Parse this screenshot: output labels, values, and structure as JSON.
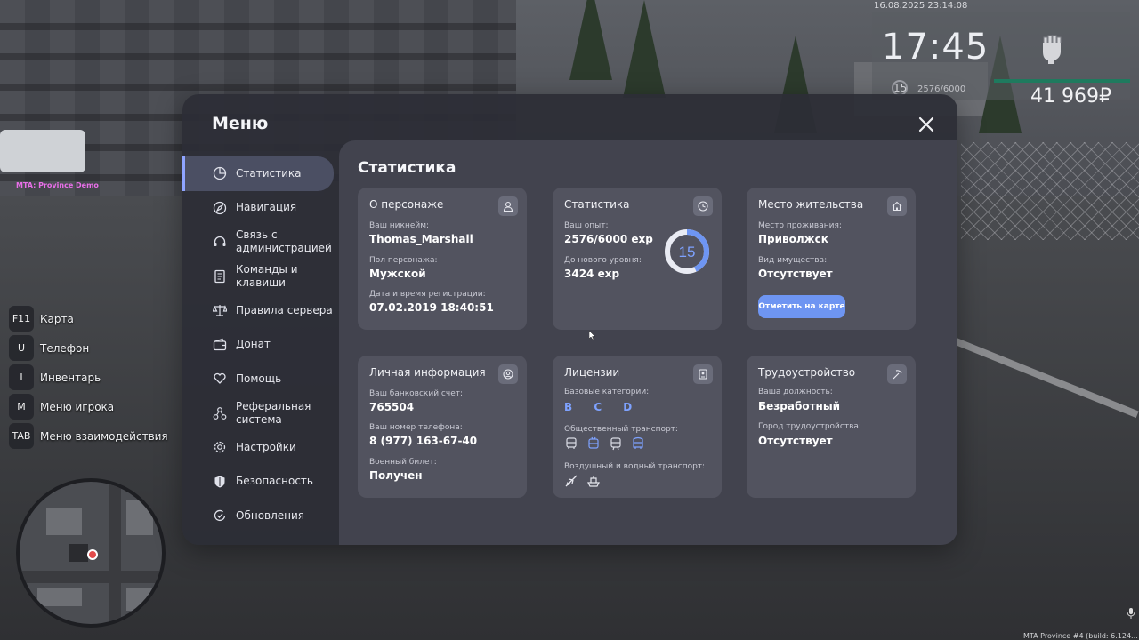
{
  "hud": {
    "datetime": "16.08.2025 23:14:08",
    "time": "17:45",
    "level": "15",
    "exp": "2576/6000",
    "money": "41 969₽"
  },
  "server_label": "MTA: Province Demo",
  "hotkeys": [
    {
      "key": "F11",
      "label": "Карта"
    },
    {
      "key": "U",
      "label": "Телефон"
    },
    {
      "key": "I",
      "label": "Инвентарь"
    },
    {
      "key": "M",
      "label": "Меню игрока"
    },
    {
      "key": "TAB",
      "label": "Меню взаимодействия"
    }
  ],
  "menu": {
    "title": "Меню",
    "nav": [
      {
        "label": "Статистика",
        "icon": "pie-chart-icon",
        "active": true
      },
      {
        "label": "Навигация",
        "icon": "compass-icon"
      },
      {
        "label": "Связь с\nадминистрацией",
        "icon": "headset-icon"
      },
      {
        "label": "Команды и\nклавиши",
        "icon": "document-icon"
      },
      {
        "label": "Правила сервера",
        "icon": "scales-icon"
      },
      {
        "label": "Донат",
        "icon": "wallet-icon"
      },
      {
        "label": "Помощь",
        "icon": "heart-hand-icon"
      },
      {
        "label": "Реферальная\nсистема",
        "icon": "referral-icon"
      },
      {
        "label": "Настройки",
        "icon": "gear-icon"
      },
      {
        "label": "Безопасность",
        "icon": "shield-icon"
      },
      {
        "label": "Обновления",
        "icon": "check-refresh-icon"
      }
    ]
  },
  "content": {
    "title": "Статистика",
    "character": {
      "title": "О персонаже",
      "nick_label": "Ваш никнейм:",
      "nick": "Thomas_Marshall",
      "gender_label": "Пол персонажа:",
      "gender": "Мужской",
      "reg_label": "Дата и время регистрации:",
      "reg": "07.02.2019 18:40:51"
    },
    "stats": {
      "title": "Статистика",
      "exp_label": "Ваш опыт:",
      "exp": "2576/6000 exp",
      "next_label": "До нового уровня:",
      "next": "3424 exp",
      "level": "15",
      "progress": 0.4293
    },
    "residence": {
      "title": "Место жительства",
      "place_label": "Место проживания:",
      "place": "Приволжск",
      "property_label": "Вид имущества:",
      "property": "Отсутствует",
      "button": "Отметить на карте"
    },
    "personal": {
      "title": "Личная информация",
      "bank_label": "Ваш банковский счет:",
      "bank": "765504",
      "phone_label": "Ваш номер телефона:",
      "phone": "8 (977) 163-67-40",
      "military_label": "Военный билет:",
      "military": "Получен"
    },
    "licenses": {
      "title": "Лицензии",
      "base_label": "Базовые категории:",
      "base": "B C D",
      "public_label": "Общественный транспорт:",
      "air_label": "Воздушный и водный транспорт:"
    },
    "employment": {
      "title": "Трудоустройство",
      "position_label": "Ваша должность:",
      "position": "Безработный",
      "city_label": "Город трудоустройства:",
      "city": "Отсутствует"
    }
  },
  "build": "MTA Province #4 (build: 6.124..."
}
